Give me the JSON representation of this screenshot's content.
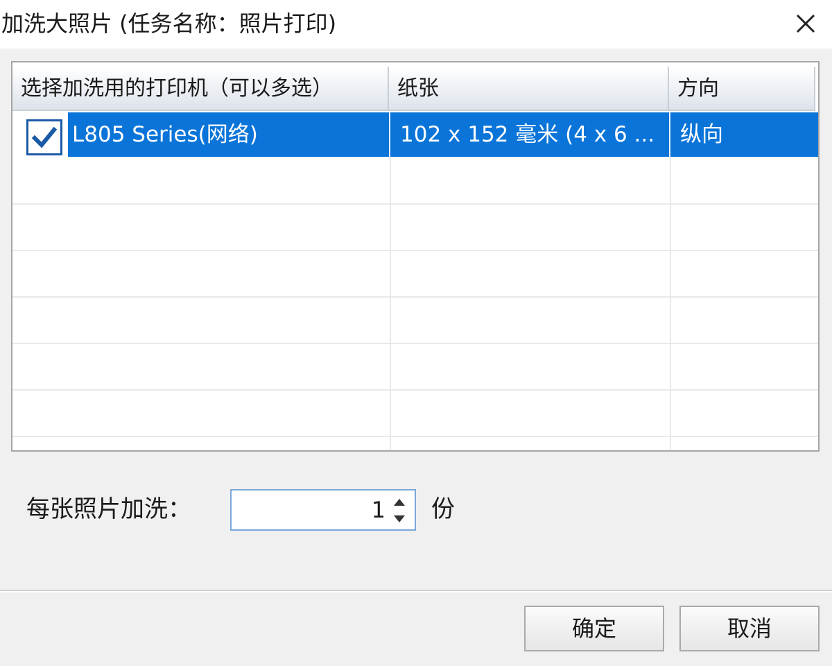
{
  "window": {
    "title": "加洗大照片 (任务名称：照片打印)",
    "close_icon": "close-icon"
  },
  "printer_list": {
    "columns": [
      "选择加洗用的打印机（可以多选）",
      "纸张",
      "方向"
    ],
    "rows": [
      {
        "checked": true,
        "printer": "L805 Series(网络)",
        "paper": "102 x 152 毫米 (4 x 6 ...",
        "orientation": "纵向"
      }
    ],
    "selection_color": "#0a74d8"
  },
  "copies": {
    "label": "每张照片加洗：",
    "value": "1",
    "unit": "份"
  },
  "buttons": {
    "ok": "确定",
    "cancel": "取消"
  }
}
